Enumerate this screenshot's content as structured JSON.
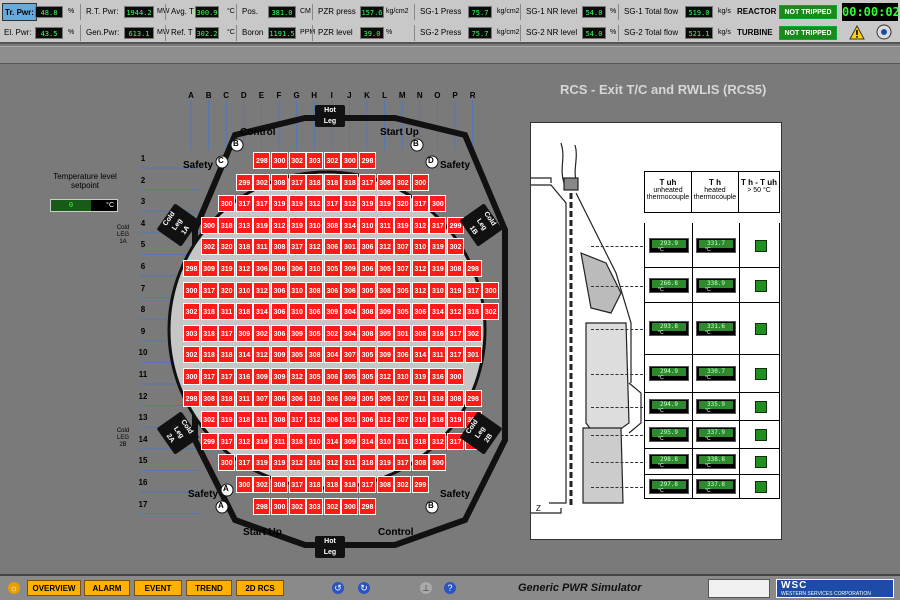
{
  "top": {
    "row1": [
      {
        "label": "Tr. Pwr:",
        "value": "48.8",
        "unit": "%"
      },
      {
        "label": "R.T. Pwr:",
        "value": "1944.2",
        "unit": "MW"
      },
      {
        "label": "Avg. T",
        "value": "300.9",
        "unit": "°C"
      },
      {
        "label": "Pos.",
        "value": "381.0",
        "unit": "CM"
      },
      {
        "label": "PZR press",
        "value": "157.6",
        "unit": "kg/cm2"
      },
      {
        "label": "SG-1 Press",
        "value": "75.7",
        "unit": "kg/cm2"
      },
      {
        "label": "SG-1 NR level",
        "value": "54.0",
        "unit": "%"
      },
      {
        "label": "SG-1 Total flow",
        "value": "519.0",
        "unit": "kg/s"
      }
    ],
    "row2": [
      {
        "label": "El. Pwr:",
        "value": "43.5",
        "unit": "%"
      },
      {
        "label": "Gen.Pwr:",
        "value": "613.1",
        "unit": "MW"
      },
      {
        "label": "Ref. T",
        "value": "302.2",
        "unit": "°C"
      },
      {
        "label": "Boron",
        "value": "1191.5",
        "unit": "PPM"
      },
      {
        "label": "PZR level",
        "value": "39.0",
        "unit": "%"
      },
      {
        "label": "SG-2 Press",
        "value": "75.7",
        "unit": "kg/cm2"
      },
      {
        "label": "SG-2 NR level",
        "value": "54.0",
        "unit": "%"
      },
      {
        "label": "SG-2 Total flow",
        "value": "521.1",
        "unit": "kg/s"
      }
    ],
    "reactor_label": "REACTOR",
    "turbine_label": "TURBINE",
    "reactor_status": "NOT TRIPPED",
    "turbine_status": "NOT TRIPPED",
    "clock": "00:00:02"
  },
  "title": "RCS - Exit T/C and RWLIS (RCS5)",
  "core": {
    "columns": [
      "A",
      "B",
      "C",
      "D",
      "E",
      "F",
      "G",
      "H",
      "I",
      "J",
      "K",
      "L",
      "M",
      "N",
      "O",
      "P",
      "R"
    ],
    "rows": [
      "1",
      "2",
      "3",
      "4",
      "5",
      "6",
      "7",
      "8",
      "9",
      "10",
      "11",
      "12",
      "13",
      "14",
      "15",
      "16",
      "17"
    ],
    "grid": [
      [
        null,
        null,
        null,
        null,
        null,
        null,
        null,
        null,
        null,
        null,
        null,
        null,
        null,
        null,
        null,
        null,
        null
      ],
      [
        null,
        null,
        null,
        null,
        null,
        "298",
        "300",
        "302",
        "303",
        "302",
        "300",
        "298",
        null,
        null,
        null,
        null,
        null
      ],
      [
        null,
        null,
        null,
        null,
        "299",
        "302",
        "308",
        "317",
        "318",
        "318",
        "318",
        "317",
        "308",
        "302",
        "300",
        null,
        null
      ],
      [
        null,
        null,
        null,
        "300",
        "317",
        "317",
        "319",
        "319",
        "312",
        "317",
        "312",
        "319",
        "319",
        "320",
        "317",
        "300",
        null
      ],
      [
        null,
        null,
        "300",
        "318",
        "313",
        "319",
        "312",
        "319",
        "310",
        "308",
        "314",
        "310",
        "311",
        "319",
        "312",
        "317",
        "299"
      ],
      [
        null,
        null,
        "302",
        "320",
        "318",
        "311",
        "308",
        "317",
        "312",
        "306",
        "301",
        "306",
        "312",
        "307",
        "310",
        "319",
        "302"
      ],
      [
        null,
        "298",
        "309",
        "319",
        "312",
        "306",
        "306",
        "306",
        "310",
        "305",
        "309",
        "306",
        "305",
        "307",
        "312",
        "319",
        "308",
        "298"
      ],
      [
        null,
        "300",
        "317",
        "320",
        "310",
        "312",
        "306",
        "310",
        "308",
        "306",
        "306",
        "305",
        "308",
        "305",
        "312",
        "310",
        "319",
        "317",
        "300"
      ],
      [
        null,
        "302",
        "318",
        "311",
        "318",
        "314",
        "306",
        "310",
        "306",
        "309",
        "304",
        "308",
        "309",
        "305",
        "306",
        "314",
        "312",
        "318",
        "302"
      ],
      [
        null,
        "303",
        "318",
        "317",
        "309",
        "302",
        "306",
        "309",
        "305",
        "302",
        "304",
        "308",
        "305",
        "301",
        "308",
        "316",
        "317",
        "302"
      ],
      [
        null,
        "302",
        "318",
        "318",
        "314",
        "312",
        "309",
        "305",
        "308",
        "304",
        "307",
        "305",
        "309",
        "306",
        "314",
        "311",
        "317",
        "301"
      ],
      [
        null,
        "300",
        "317",
        "317",
        "316",
        "309",
        "309",
        "312",
        "305",
        "306",
        "305",
        "305",
        "312",
        "310",
        "319",
        "316",
        "300"
      ],
      [
        null,
        "298",
        "308",
        "318",
        "311",
        "307",
        "306",
        "306",
        "310",
        "306",
        "309",
        "305",
        "305",
        "307",
        "311",
        "318",
        "308",
        "298"
      ],
      [
        null,
        null,
        "302",
        "319",
        "318",
        "311",
        "308",
        "317",
        "312",
        "306",
        "301",
        "306",
        "312",
        "307",
        "310",
        "318",
        "319",
        "302"
      ],
      [
        null,
        null,
        "299",
        "317",
        "312",
        "319",
        "311",
        "318",
        "310",
        "314",
        "309",
        "314",
        "310",
        "311",
        "318",
        "312",
        "317",
        "299"
      ],
      [
        null,
        null,
        null,
        "300",
        "317",
        "319",
        "319",
        "312",
        "316",
        "312",
        "311",
        "318",
        "319",
        "317",
        "308",
        "300",
        null
      ],
      [
        null,
        null,
        null,
        null,
        "300",
        "302",
        "308",
        "317",
        "318",
        "318",
        "318",
        "317",
        "308",
        "302",
        "299",
        null,
        null
      ],
      [
        null,
        null,
        null,
        null,
        null,
        "298",
        "300",
        "302",
        "303",
        "302",
        "300",
        "298",
        null,
        null,
        null,
        null,
        null
      ]
    ],
    "labels": {
      "control_top": "Control",
      "startup_top": "Start Up",
      "safety_tl": "Safety",
      "safety_tr": "Safety",
      "safety_bl": "Safety",
      "safety_br": "Safety",
      "startup_bottom": "Start Up",
      "control_bottom": "Control",
      "hot_leg": "Hot\nLeg",
      "cold_leg_1a": "Cold\nLeg\n1A",
      "cold_leg_1b": "Cold\nLeg\n1B",
      "cold_leg_2a": "Cold\nLeg\n2A",
      "cold_leg_2b": "Cold\nLeg\n2B",
      "cold_leg_1a_side": "Cold\nLEG\n1A",
      "cold_leg_2b_side": "Cold\nLEG\n2B",
      "marker_a": "A",
      "marker_b": "B",
      "marker_c": "C",
      "marker_d": "D"
    },
    "temp_level_label": "Temperature level setpoint",
    "temp_level_value": "0",
    "temp_level_unit": "°C"
  },
  "panel": {
    "headers": [
      {
        "title": "T uh",
        "sub": "unheated thermocouple"
      },
      {
        "title": "T h",
        "sub": "heated thermocouple"
      },
      {
        "title": "T h - T uh",
        "sub": "> 50 °C"
      }
    ],
    "rows": [
      {
        "tuh": "293.9",
        "th": "331.7",
        "unit": "°C"
      },
      {
        "tuh": "266.8",
        "th": "338.9",
        "unit": "°C"
      },
      {
        "tuh": "293.8",
        "th": "331.6",
        "unit": "°C"
      },
      {
        "tuh": "294.9",
        "th": "330.7",
        "unit": "°C"
      },
      {
        "tuh": "294.9",
        "th": "335.9",
        "unit": "°C"
      },
      {
        "tuh": "295.9",
        "th": "337.9",
        "unit": "°C"
      },
      {
        "tuh": "298.8",
        "th": "338.8",
        "unit": "°C"
      },
      {
        "tuh": "297.8",
        "th": "337.8",
        "unit": "°C"
      }
    ]
  },
  "nav": {
    "buttons": [
      "OVERVIEW",
      "ALARM",
      "EVENT",
      "TREND",
      "2D RCS"
    ],
    "brand": "Generic PWR Simulator",
    "company": "WSC",
    "company_full": "WESTERN SERVICES CORPORATION"
  },
  "colors": {
    "hot_cell": "#ff1a1a",
    "ok_indicator": "#1f8f1f",
    "nav_button": "#ffb000"
  }
}
